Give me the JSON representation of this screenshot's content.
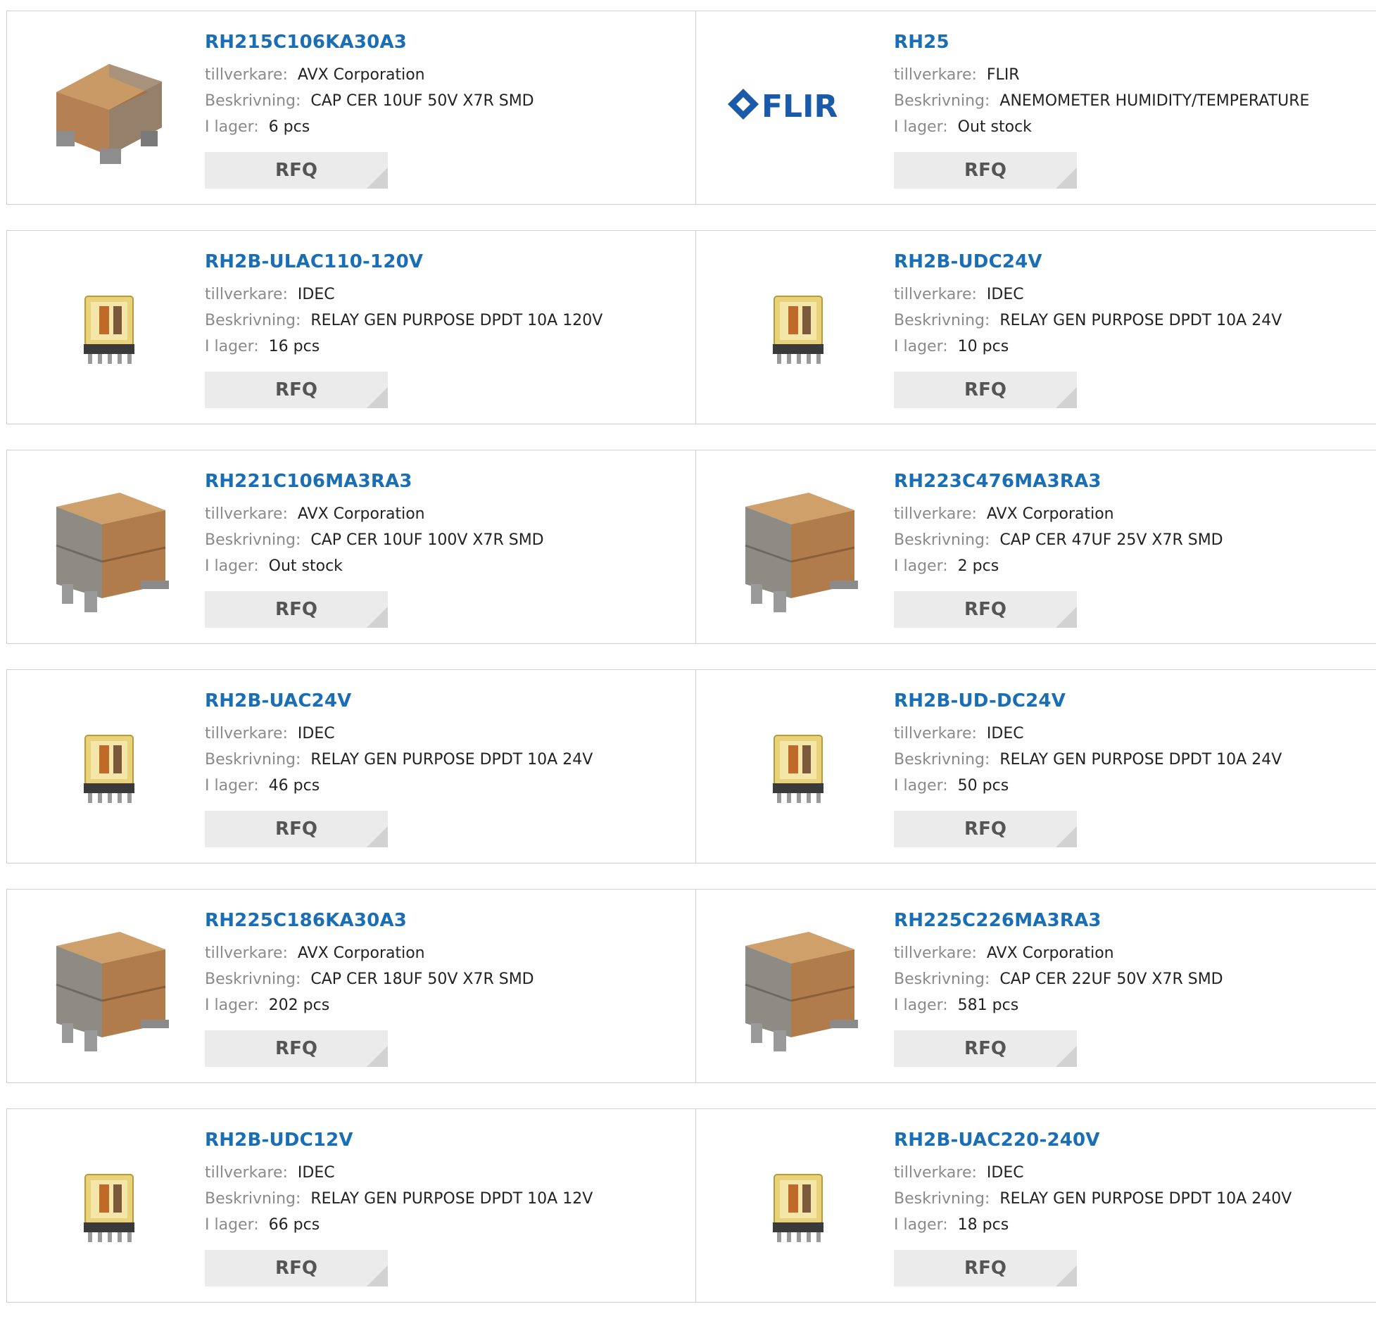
{
  "labels": {
    "manufacturer": "tillverkare:",
    "description": "Beskrivning:",
    "stock": "I lager:",
    "rfq": "RFQ"
  },
  "products": [
    {
      "part": "RH215C106KA30A3",
      "manufacturer": "AVX Corporation",
      "description": "CAP CER 10UF 50V X7R SMD",
      "stock": "6 pcs",
      "image": "capacitor-single"
    },
    {
      "part": "RH25",
      "manufacturer": "FLIR",
      "description": "ANEMOMETER HUMIDITY/TEMPERATURE",
      "stock": "Out stock",
      "image": "flir-logo",
      "logo_text": "FLIR"
    },
    {
      "part": "RH2B-ULAC110-120V",
      "manufacturer": "IDEC",
      "description": "RELAY GEN PURPOSE DPDT 10A 120V",
      "stock": "16 pcs",
      "image": "relay"
    },
    {
      "part": "RH2B-UDC24V",
      "manufacturer": "IDEC",
      "description": "RELAY GEN PURPOSE DPDT 10A 24V",
      "stock": "10 pcs",
      "image": "relay"
    },
    {
      "part": "RH221C106MA3RA3",
      "manufacturer": "AVX Corporation",
      "description": "CAP CER 10UF 100V X7R SMD",
      "stock": "Out stock",
      "image": "capacitor-stacked"
    },
    {
      "part": "RH223C476MA3RA3",
      "manufacturer": "AVX Corporation",
      "description": "CAP CER 47UF 25V X7R SMD",
      "stock": "2 pcs",
      "image": "capacitor-stacked"
    },
    {
      "part": "RH2B-UAC24V",
      "manufacturer": "IDEC",
      "description": "RELAY GEN PURPOSE DPDT 10A 24V",
      "stock": "46 pcs",
      "image": "relay"
    },
    {
      "part": "RH2B-UD-DC24V",
      "manufacturer": "IDEC",
      "description": "RELAY GEN PURPOSE DPDT 10A 24V",
      "stock": "50 pcs",
      "image": "relay"
    },
    {
      "part": "RH225C186KA30A3",
      "manufacturer": "AVX Corporation",
      "description": "CAP CER 18UF 50V X7R SMD",
      "stock": "202 pcs",
      "image": "capacitor-stacked"
    },
    {
      "part": "RH225C226MA3RA3",
      "manufacturer": "AVX Corporation",
      "description": "CAP CER 22UF 50V X7R SMD",
      "stock": "581 pcs",
      "image": "capacitor-stacked"
    },
    {
      "part": "RH2B-UDC12V",
      "manufacturer": "IDEC",
      "description": "RELAY GEN PURPOSE DPDT 10A 12V",
      "stock": "66 pcs",
      "image": "relay"
    },
    {
      "part": "RH2B-UAC220-240V",
      "manufacturer": "IDEC",
      "description": "RELAY GEN PURPOSE DPDT 10A 240V",
      "stock": "18 pcs",
      "image": "relay"
    }
  ],
  "colors": {
    "link": "#1a6eb5",
    "label": "#8a8a8a",
    "value": "#222222",
    "button_bg": "#ebebeb",
    "button_text": "#555555",
    "border": "#cfcfcf",
    "flir_blue": "#1a5aa8"
  }
}
